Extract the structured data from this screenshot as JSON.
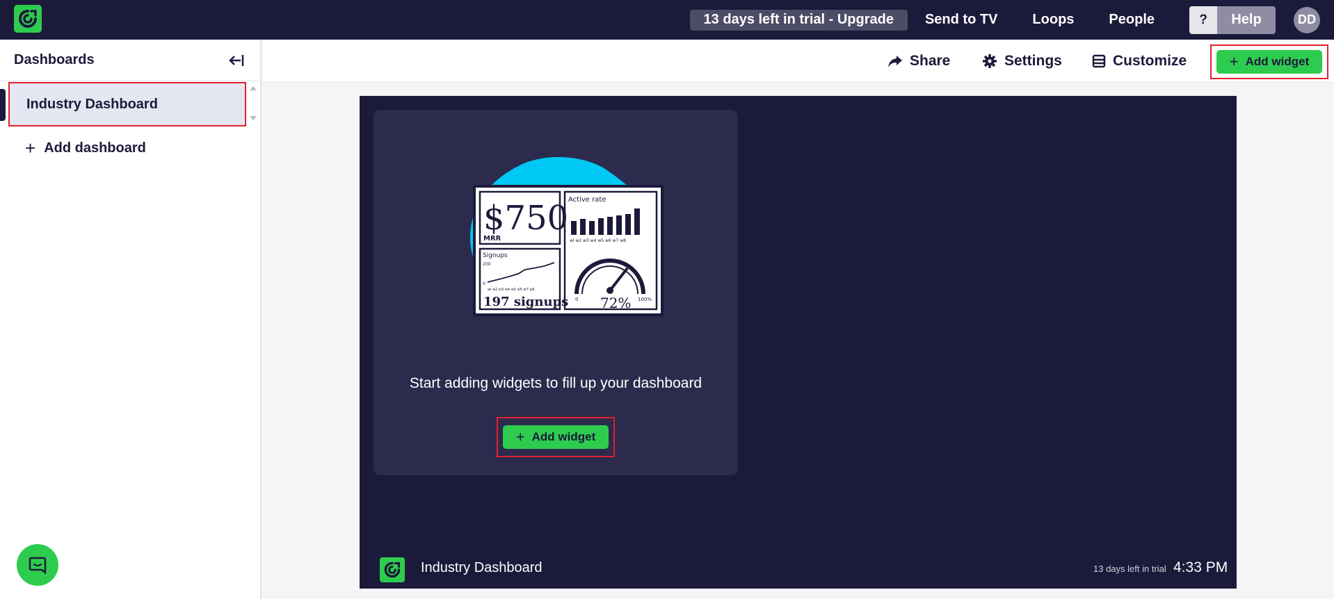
{
  "topbar": {
    "trial_label": "13 days left in trial - Upgrade",
    "send_to_tv": "Send to TV",
    "loops": "Loops",
    "people": "People",
    "help_q": "?",
    "help": "Help",
    "avatar_initials": "DD"
  },
  "sidebar": {
    "title": "Dashboards",
    "items": [
      {
        "label": "Industry Dashboard",
        "active": true
      }
    ],
    "add_dashboard": "Add dashboard"
  },
  "toolbar": {
    "share": "Share",
    "settings": "Settings",
    "customize": "Customize",
    "add_widget": "Add widget"
  },
  "canvas": {
    "empty_message": "Start adding widgets to fill up your dashboard",
    "add_widget": "Add widget",
    "footer_title": "Industry Dashboard",
    "footer_trial": "13 days left in trial",
    "footer_time": "4:33 PM"
  },
  "illustration": {
    "mrr_value": "$750",
    "mrr_label": "MRR",
    "active_rate_label": "Active rate",
    "bar_labels": "wi w2 w3 w4 w5 w6 w7 w8",
    "signups_label": "Signups",
    "signups_axis_top": "200",
    "signups_axis_bottom": "0",
    "signups_week_labels": "wi w2 w3 w4 w5 w6 w7 w8",
    "signups_value": "197 signups",
    "gauge_value": "72%",
    "gauge_min": "0",
    "gauge_max": "100%"
  },
  "colors": {
    "navy": "#1c1a3a",
    "green": "#2ecc4e",
    "highlight_red": "#e3202a",
    "blob_blue": "#00c8f5"
  }
}
